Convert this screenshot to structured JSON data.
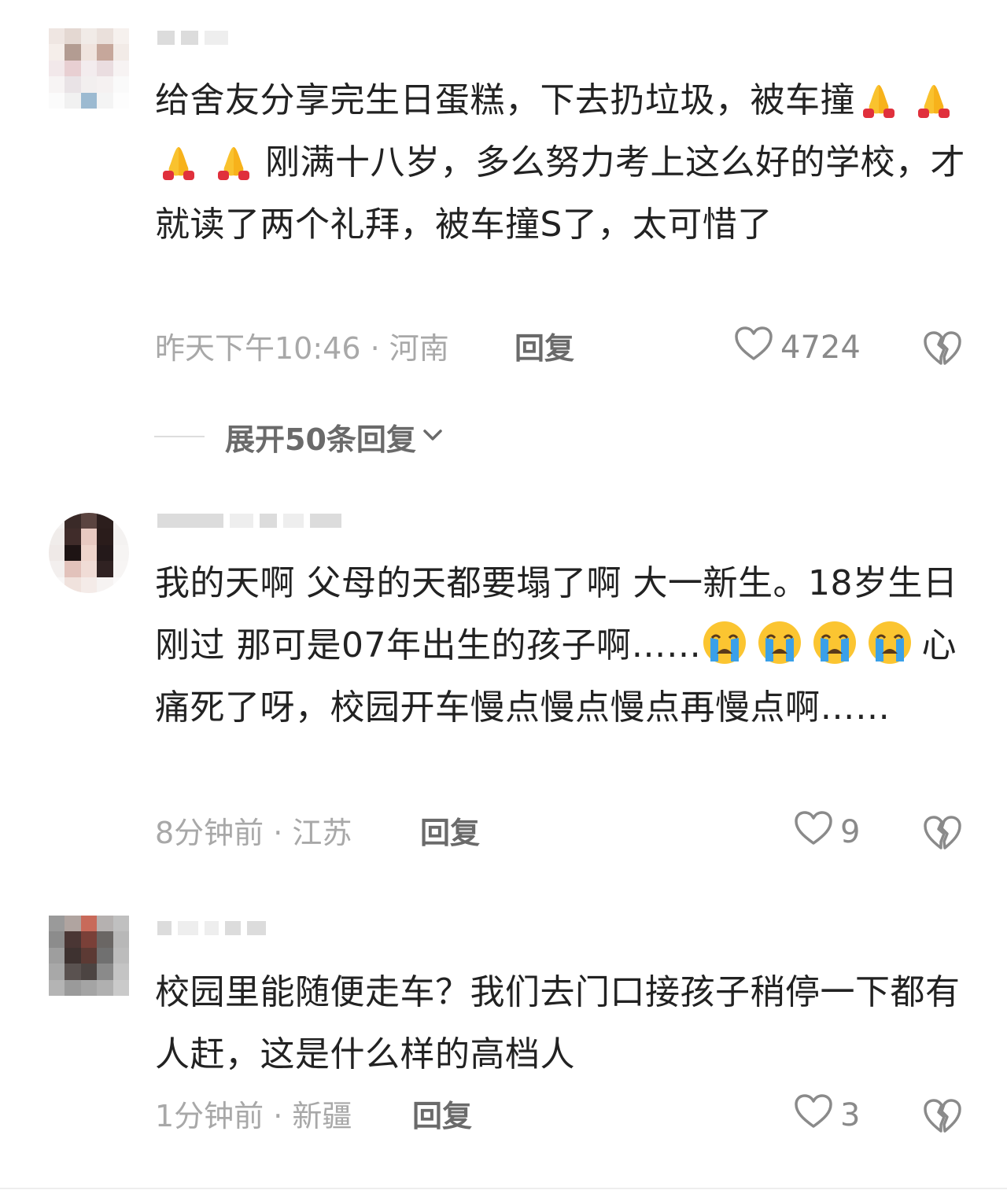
{
  "comments": [
    {
      "text_a": "给舍友分享完生日蛋糕，下去扔垃圾，被车撞",
      "text_b": "刚满十八岁，多么努力考上这么好的学校，才就读了两个礼拜，被车撞S了，太可惜了",
      "emoji_count_b": 4,
      "emoji": "praying-hands",
      "meta": "昨天下午10:46 · 河南",
      "reply_label": "回复",
      "likes": "4724",
      "expand_label": "展开50条回复"
    },
    {
      "text_a": "我的天啊 父母的天都要塌了啊 大一新生。18岁生日刚过 那可是07年出生的孩子啊……",
      "text_b": "心痛死了呀，校园开车慢点慢点慢点再慢点啊……",
      "emoji": "loudly-crying-face",
      "meta": "8分钟前 · 江苏",
      "reply_label": "回复",
      "likes": "9"
    },
    {
      "text_a": "校园里能随便走车？我们去门口接孩子稍停一下都有人赶，这是什么样的高档人",
      "meta": "1分钟前 · 新疆",
      "reply_label": "回复",
      "likes": "3"
    }
  ],
  "icons": {
    "like": "heart-outline-icon",
    "dislike": "broken-heart-icon",
    "expand": "chevron-down-icon"
  },
  "colors": {
    "text": "#222222",
    "meta": "#a8a8a8",
    "action": "#6a6a6a",
    "icon": "#8a8a8a"
  }
}
